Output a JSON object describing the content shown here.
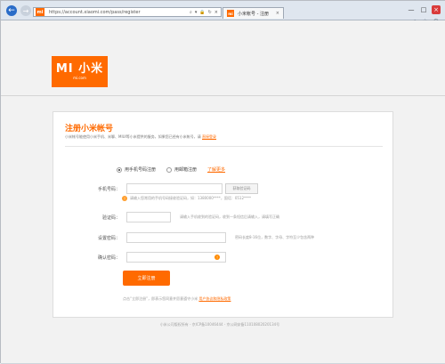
{
  "browser": {
    "back_icon": "←",
    "forward_icon": "→",
    "address_icon": "mi",
    "url": "https://account.xiaomi.com/pass/register",
    "address_tools": [
      "⌕",
      "▾",
      "🔒",
      "↻",
      "×"
    ],
    "tab_favicon": "mi",
    "tab_title": "小米帐号 - 注册",
    "tab_close": "×",
    "window_controls": [
      "—",
      "□",
      "×"
    ],
    "toolbar_icons": [
      "⌂",
      "☆",
      "⚙"
    ]
  },
  "logo": {
    "mark": "MI 小米",
    "brand": "mi.com"
  },
  "registration": {
    "title": "注册小米帐号",
    "subtitle_prefix": "小米帐号能使用小米手机、米聊、MIUI等小米提供的服务，如果您已经有小米帐号，请",
    "subtitle_link": "直接登录",
    "radio_phone": "用手机号码注册",
    "radio_email": "用邮箱注册",
    "learn_more": "了解更多",
    "phone_label": "手机号码：",
    "phone_placeholder": "",
    "code_button": "获取验证码",
    "info_text": "请输入您常用的手机号码接收验证码，如：1380000****，固话：0512****",
    "code_label": "验证码：",
    "code_hint": "请输入手机收到的验证码，收到一条短信后请输入，请填写正确",
    "password_label": "设置密码：",
    "password_hint": "密码长度8-16位，数字、字母、字符至少包含两种",
    "confirm_label": "确认密码：",
    "confirm_hint": "",
    "eye_icon": "!",
    "submit_button": "立即注册",
    "agreement_prefix": "点击“立即注册”，即表示您同意并愿意遵守小米",
    "agreement_link": "用户协议和隐私政策"
  },
  "footer": {
    "text": "小米公司版权所有 - 京ICP备10046444 - 京公网安备11010802020134号"
  }
}
